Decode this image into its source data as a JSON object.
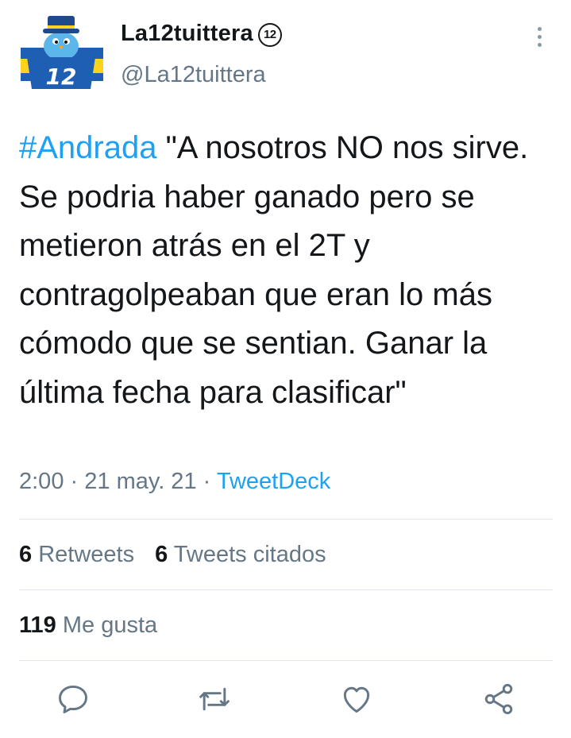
{
  "author": {
    "display_name": "La12tuittera",
    "badge": "12",
    "handle": "@La12tuittera",
    "avatar_text": "12"
  },
  "tweet": {
    "hashtag": "#Andrada",
    "text": " \"A nosotros NO nos sirve. Se podria haber ganado pero se metieron atrás en el 2T y contragolpeaban que eran lo más cómodo que se sentian. Ganar la última fecha para clasificar\"",
    "time": "2:00",
    "separator": "·",
    "date": "21 may. 21",
    "source": "TweetDeck"
  },
  "stats": {
    "retweets_count": "6",
    "retweets_label": "Retweets",
    "quotes_count": "6",
    "quotes_label": "Tweets citados",
    "likes_count": "119",
    "likes_label": "Me gusta"
  },
  "actions": {
    "icons": [
      "reply-icon",
      "retweet-icon",
      "like-icon",
      "share-icon"
    ]
  },
  "colors": {
    "text": "#14171a",
    "secondary": "#657786",
    "accent": "#1da1f2",
    "divider": "#e1e8ed",
    "avatar_blue": "#1e5fb4",
    "avatar_yellow": "#ffd21f"
  }
}
